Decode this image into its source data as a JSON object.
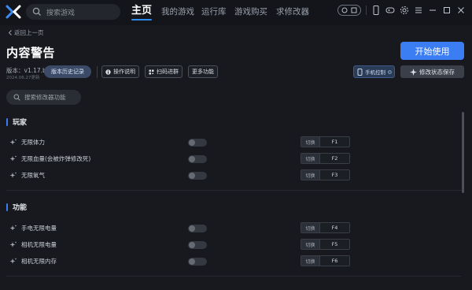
{
  "titlebar": {
    "logo_icon": "app-logo-icon",
    "search_placeholder": "搜索游戏",
    "nav": [
      {
        "label": "主页",
        "active": true
      },
      {
        "label": "我的游戏",
        "active": false
      },
      {
        "label": "运行库",
        "active": false
      },
      {
        "label": "游戏购买",
        "active": false
      },
      {
        "label": "求修改器",
        "active": false
      }
    ],
    "icons": [
      "theme-toggle-icon",
      "phone-icon",
      "gamepad-icon",
      "settings-icon",
      "menu-icon",
      "minimize-icon",
      "maximize-icon",
      "close-icon"
    ]
  },
  "page": {
    "back_label": "返回上一页",
    "title": "内容警告",
    "version": "版本：v1.17.b",
    "version_date": "2024.06.27更新",
    "history_button": "版本历史记录",
    "tools": [
      {
        "label": "操作说明",
        "icon": "info-icon"
      },
      {
        "label": "扫码进群",
        "icon": "qr-code-icon"
      },
      {
        "label": "更多功能",
        "icon": ""
      }
    ],
    "start_button": "开始使用",
    "phone_control": "手机控制",
    "save_state": "修改状态保存",
    "search_mod_placeholder": "搜索修改器功能"
  },
  "sections": [
    {
      "title": "玩家",
      "items": [
        {
          "label": "无限体力",
          "enabled": false,
          "action": "切换",
          "key": "F1"
        },
        {
          "label": "无限血量(会被炸弹修改死)",
          "enabled": false,
          "action": "切换",
          "key": "F2"
        },
        {
          "label": "无限氧气",
          "enabled": false,
          "action": "切换",
          "key": "F3"
        }
      ]
    },
    {
      "title": "功能",
      "items": [
        {
          "label": "手电无限电量",
          "enabled": false,
          "action": "切换",
          "key": "F4"
        },
        {
          "label": "相机无限电量",
          "enabled": false,
          "action": "切换",
          "key": "F5"
        },
        {
          "label": "相机无限内存",
          "enabled": false,
          "action": "切换",
          "key": "F6"
        }
      ]
    }
  ],
  "colors": {
    "accent": "#3b7df2",
    "background": "#17191e",
    "titlebar": "#13151a"
  }
}
